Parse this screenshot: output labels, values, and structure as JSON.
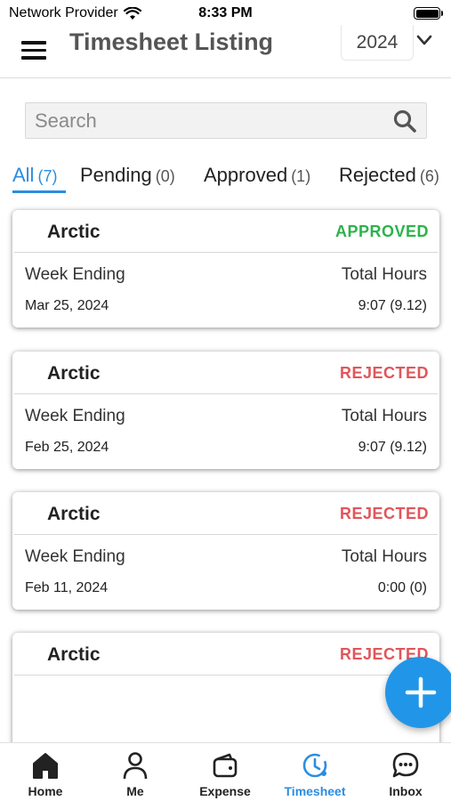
{
  "status_bar": {
    "carrier": "Network Provider",
    "time": "8:33 PM"
  },
  "header": {
    "title": "Timesheet Listing",
    "year": "2024"
  },
  "search": {
    "placeholder": "Search"
  },
  "tabs": [
    {
      "label": "All",
      "count": "(7)",
      "active": true
    },
    {
      "label": "Pending",
      "count": "(0)"
    },
    {
      "label": "Approved",
      "count": "(1)"
    },
    {
      "label": "Rejected",
      "count": "(6)"
    }
  ],
  "cards": [
    {
      "name": "Arctic",
      "status": "APPROVED",
      "week_label": "Week Ending",
      "hours_label": "Total Hours",
      "date": "Mar 25, 2024",
      "hours": "9:07 (9.12)"
    },
    {
      "name": "Arctic",
      "status": "REJECTED",
      "week_label": "Week Ending",
      "hours_label": "Total Hours",
      "date": "Feb 25, 2024",
      "hours": "9:07 (9.12)"
    },
    {
      "name": "Arctic",
      "status": "REJECTED",
      "week_label": "Week Ending",
      "hours_label": "Total Hours",
      "date": "Feb 11, 2024",
      "hours": "0:00 (0)"
    },
    {
      "name": "Arctic",
      "status": "REJECTED"
    }
  ],
  "bottom_nav": [
    {
      "label": "Home",
      "icon": "home-icon"
    },
    {
      "label": "Me",
      "icon": "person-icon"
    },
    {
      "label": "Expense",
      "icon": "wallet-icon"
    },
    {
      "label": "Timesheet",
      "icon": "clock-icon",
      "active": true
    },
    {
      "label": "Inbox",
      "icon": "chat-icon"
    }
  ],
  "colors": {
    "accent": "#2b8de0",
    "approved": "#2cb34a",
    "rejected": "#e0565b",
    "fab": "#2196e8"
  }
}
